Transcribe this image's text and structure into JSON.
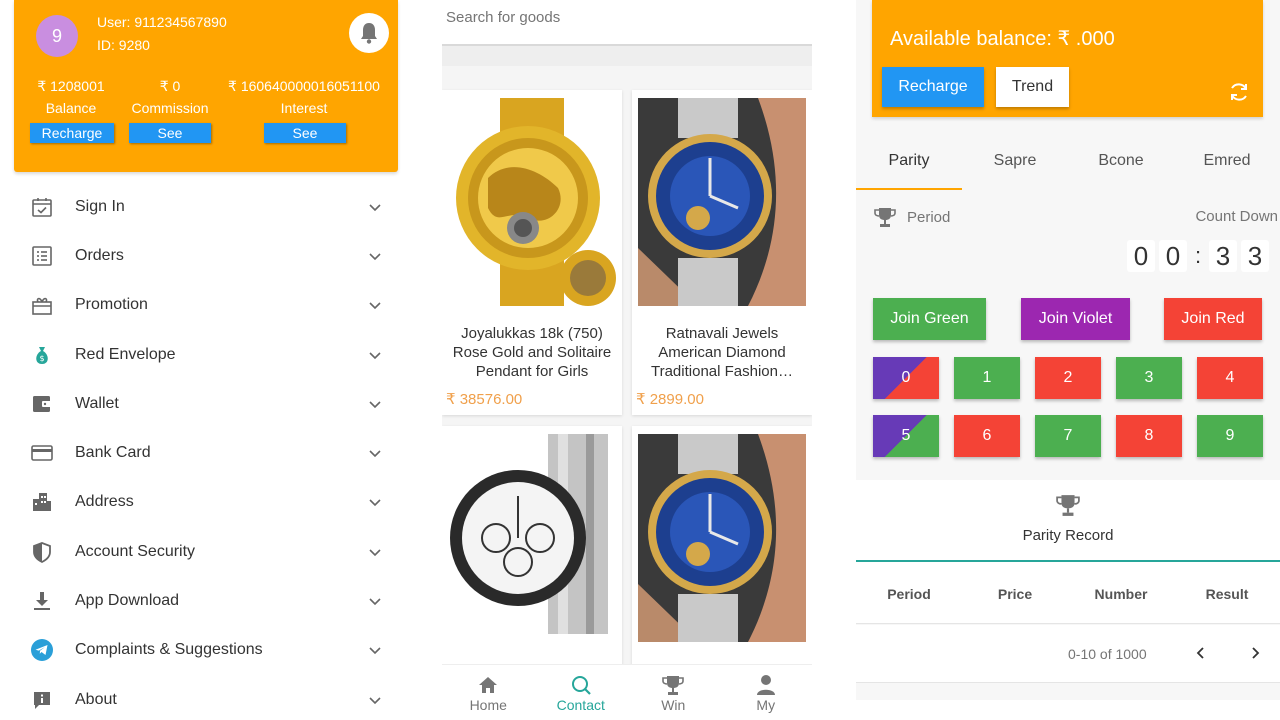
{
  "left": {
    "avatar": "9",
    "user_line": "User:  911234567890",
    "id_line": "ID:  9280",
    "stats": [
      {
        "value": "₹ 1208001",
        "label": "Balance",
        "button": "Recharge"
      },
      {
        "value": "₹ 0",
        "label": "Commission",
        "button": "See"
      },
      {
        "value": "₹ 160640000016051100",
        "label": "Interest",
        "button": "See"
      }
    ],
    "menu": [
      {
        "label": "Sign In",
        "icon": "calendar-check-icon"
      },
      {
        "label": "Orders",
        "icon": "list-icon"
      },
      {
        "label": "Promotion",
        "icon": "gift-icon"
      },
      {
        "label": "Red Envelope",
        "icon": "money-bag-icon"
      },
      {
        "label": "Wallet",
        "icon": "wallet-icon"
      },
      {
        "label": "Bank Card",
        "icon": "credit-card-icon"
      },
      {
        "label": "Address",
        "icon": "building-icon"
      },
      {
        "label": "Account Security",
        "icon": "shield-icon"
      },
      {
        "label": "App Download",
        "icon": "download-icon"
      },
      {
        "label": "Complaints & Suggestions",
        "icon": "telegram-icon"
      },
      {
        "label": "About",
        "icon": "info-icon"
      }
    ]
  },
  "mid": {
    "search_placeholder": "Search for goods",
    "products": [
      {
        "name": "Joyalukkas 18k (750) Rose Gold and Solitaire Pendant for Girls",
        "price": "₹ 38576.00",
        "image": "gold-watch"
      },
      {
        "name": "Ratnavali Jewels American Diamond Traditional Fashion…",
        "price": "₹ 2899.00",
        "image": "blue-dial-watch"
      },
      {
        "name": "",
        "price": "",
        "image": "chronograph-watch"
      },
      {
        "name": "",
        "price": "",
        "image": "blue-dial-watch"
      }
    ],
    "nav": [
      {
        "label": "Home",
        "icon": "home-icon"
      },
      {
        "label": "Contact",
        "icon": "search-icon",
        "active": true
      },
      {
        "label": "Win",
        "icon": "trophy-icon"
      },
      {
        "label": "My",
        "icon": "person-icon"
      }
    ]
  },
  "right": {
    "balance": "Available balance: ₹ .000",
    "recharge": "Recharge",
    "trend": "Trend",
    "tabs": [
      "Parity",
      "Sapre",
      "Bcone",
      "Emred"
    ],
    "period_label": "Period",
    "countdown_label": "Count Down",
    "countdown": [
      "0",
      "0",
      ":",
      "3",
      "3"
    ],
    "join": [
      {
        "label": "Join Green",
        "color": "#4caf50"
      },
      {
        "label": "Join Violet",
        "color": "#9c27b0"
      },
      {
        "label": "Join Red",
        "color": "#f44336"
      }
    ],
    "numbers": [
      "0",
      "1",
      "2",
      "3",
      "4",
      "5",
      "6",
      "7",
      "8",
      "9"
    ],
    "record_title": "Parity Record",
    "columns": [
      "Period",
      "Price",
      "Number",
      "Result"
    ],
    "pager_range": "0-10 of 1000"
  }
}
